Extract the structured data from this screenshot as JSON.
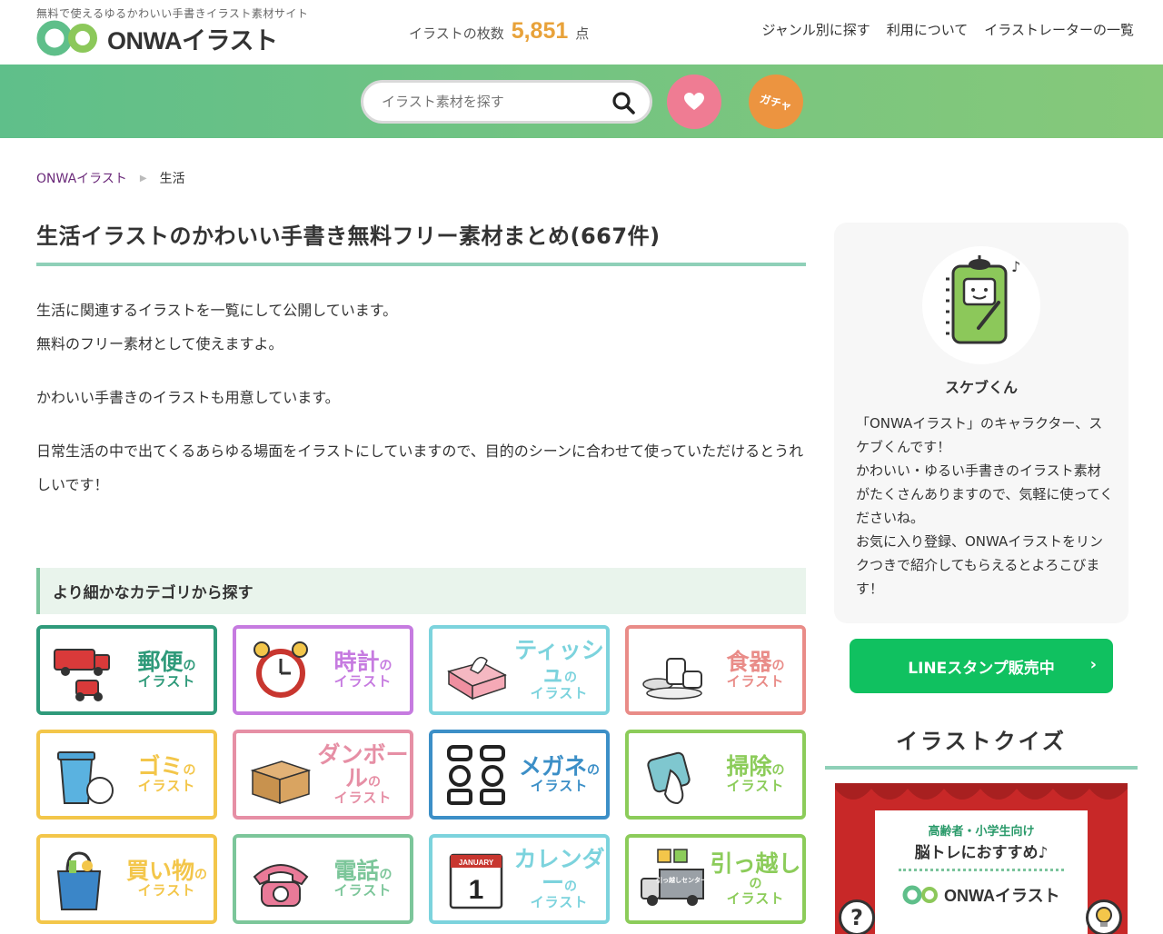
{
  "header": {
    "tagline": "無料で使えるゆるかわいい手書きイラスト素材サイト",
    "logo_text": "ONWAイラスト",
    "count_label": "イラストの枚数",
    "count_value": "5,851",
    "count_unit": "点",
    "nav": [
      "ジャンル別に探す",
      "利用について",
      "イラストレーターの一覧"
    ]
  },
  "search": {
    "placeholder": "イラスト素材を探す",
    "gacha_label": "ガチャ"
  },
  "breadcrumb": {
    "home": "ONWAイラスト",
    "separator": "▶",
    "current": "生活"
  },
  "main": {
    "title": "生活イラストのかわいい手書き無料フリー素材まとめ(667件)",
    "intro": [
      "生活に関連するイラストを一覧にして公開しています。",
      "無料のフリー素材として使えますよ。",
      "かわいい手書きのイラストも用意しています。",
      "日常生活の中で出てくるあらゆる場面をイラストにしていますので、目的のシーンに合わせて使っていただけるとうれしいです！"
    ],
    "subhead": "より細かなカテゴリから探す",
    "tiles": [
      {
        "name": "郵便",
        "no": "の",
        "suffix": "イラスト",
        "color": "#2f9a7a",
        "icon": "mail-truck-icon"
      },
      {
        "name": "時計",
        "no": "の",
        "suffix": "イラスト",
        "color": "#c67be0",
        "icon": "alarm-clock-icon"
      },
      {
        "name": "ティッシュ",
        "no": "の",
        "suffix": "イラスト",
        "color": "#7cd3dd",
        "icon": "tissue-box-icon"
      },
      {
        "name": "食器",
        "no": "の",
        "suffix": "イラスト",
        "color": "#e98c88",
        "icon": "tableware-icon"
      },
      {
        "name": "ゴミ",
        "no": "の",
        "suffix": "イラスト",
        "color": "#f3c64a",
        "icon": "trash-can-icon"
      },
      {
        "name": "ダンボール",
        "no": "の",
        "suffix": "イラスト",
        "color": "#e68fa5",
        "icon": "cardboard-box-icon"
      },
      {
        "name": "メガネ",
        "no": "の",
        "suffix": "イラスト",
        "color": "#3c8fc7",
        "icon": "glasses-icon"
      },
      {
        "name": "掃除",
        "no": "の",
        "suffix": "イラスト",
        "color": "#8ccc5a",
        "icon": "cleaning-cloth-icon"
      },
      {
        "name": "買い物",
        "no": "の",
        "suffix": "イラスト",
        "color": "#f3c64a",
        "icon": "shopping-bag-icon"
      },
      {
        "name": "電話",
        "no": "の",
        "suffix": "イラスト",
        "color": "#7cc69a",
        "icon": "telephone-icon"
      },
      {
        "name": "カレンダー",
        "no": "の",
        "suffix": "イラスト",
        "color": "#7cd3dd",
        "icon": "calendar-icon"
      },
      {
        "name": "引っ越し",
        "no": "の",
        "suffix": "イラスト",
        "color": "#8ccc5a",
        "icon": "moving-truck-icon"
      }
    ],
    "calendar_month": "JANUARY",
    "calendar_day": "1",
    "moving_truck_label": "引っ越しセンター"
  },
  "sidebar": {
    "character_name": "スケブくん",
    "character_desc": "「ONWAイラスト」のキャラクター、スケブくんです！\nかわいい・ゆるい手書きのイラスト素材がたくさんありますので、気軽に使ってくださいね。\nお気に入り登録、ONWAイラストをリンクつきで紹介してもらえるとよろこびます！",
    "line_button": "LINEスタンプ販売中",
    "line_arrow": "›",
    "quiz_title": "イラストクイズ",
    "quiz_line1": "高齢者・小学生向け",
    "quiz_line2": "脳トレにおすすめ♪",
    "quiz_logo": "ONWAイラスト"
  },
  "colors": {
    "brand_green": "#7cc67e",
    "count_orange": "#e8a23a",
    "heart_pink": "#ef7c93",
    "gacha_orange": "#ec9440",
    "line_green": "#10c160",
    "title_underline": "#8fd0b8"
  }
}
